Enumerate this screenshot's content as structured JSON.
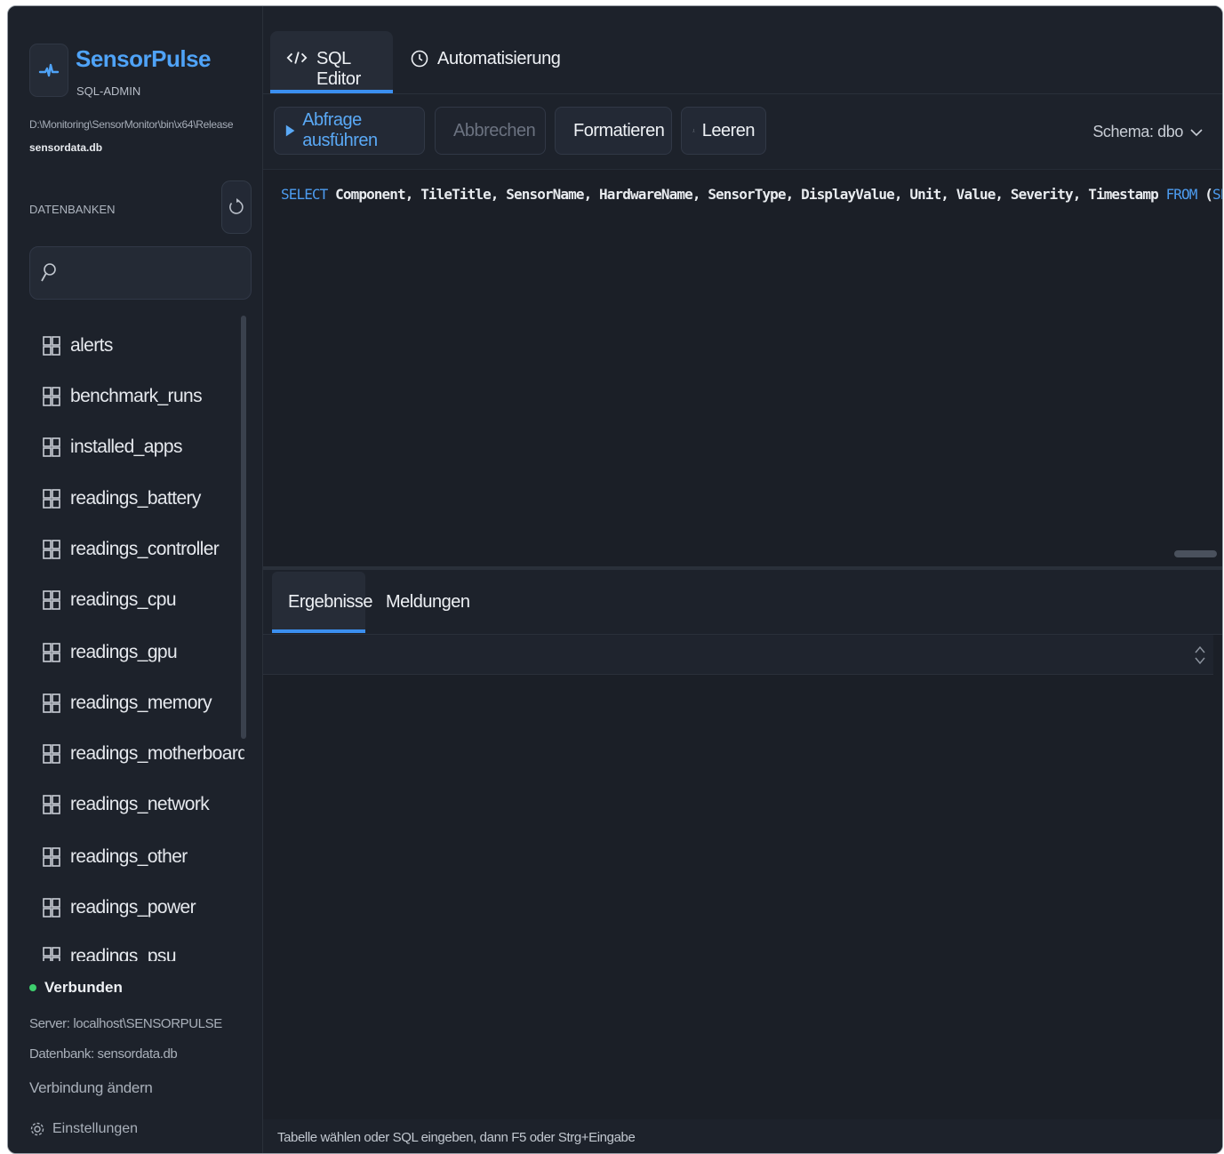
{
  "app": {
    "name": "SensorPulse",
    "subtitle": "SQL-ADMIN",
    "path": "D:\\Monitoring\\SensorMonitor\\bin\\x64\\Release",
    "db_file": "sensordata.db"
  },
  "sidebar": {
    "heading": "DATENBANKEN",
    "search": {
      "value": "",
      "placeholder": ""
    },
    "tables": [
      {
        "label": "alerts"
      },
      {
        "label": "benchmark_runs"
      },
      {
        "label": "installed_apps"
      },
      {
        "label": "readings_battery"
      },
      {
        "label": "readings_controller"
      },
      {
        "label": "readings_cpu"
      },
      {
        "label": "readings_gpu"
      },
      {
        "label": "readings_memory"
      },
      {
        "label": "readings_motherboard"
      },
      {
        "label": "readings_network"
      },
      {
        "label": "readings_other"
      },
      {
        "label": "readings_power"
      },
      {
        "label": "readings_psu"
      }
    ],
    "status": "Verbunden",
    "server": "Server: localhost\\SENSORPULSE",
    "database": "Datenbank: sensordata.db",
    "change_connection": "Verbindung ändern",
    "settings": "Einstellungen"
  },
  "tabs": [
    {
      "label": "SQL Editor",
      "icon": "code-icon",
      "active": true
    },
    {
      "label": "Automatisierung",
      "icon": "clock-icon",
      "active": false
    }
  ],
  "toolbar": {
    "run": "Abfrage ausführen",
    "cancel": "Abbrechen",
    "format": "Formatieren",
    "clear": "Leeren",
    "schema": "Schema: dbo"
  },
  "editor": {
    "keyword_select": "SELECT",
    "columns": " Component, TileTitle, SensorName, HardwareName, SensorType, DisplayValue, Unit, Value, Severity, Timestamp ",
    "keyword_from": "FROM",
    "paren": " (",
    "keyword_select2": "SELEC"
  },
  "results": {
    "tab_results": "Ergebnisse",
    "tab_messages": "Meldungen"
  },
  "statusbar": {
    "hint": "Tabelle wählen oder SQL eingeben, dann F5 oder Strg+Eingabe"
  },
  "colors": {
    "accent": "#3b8ff0",
    "brand": "#4fa3f7",
    "connected": "#3ecf6e",
    "background": "#1b1f27"
  }
}
